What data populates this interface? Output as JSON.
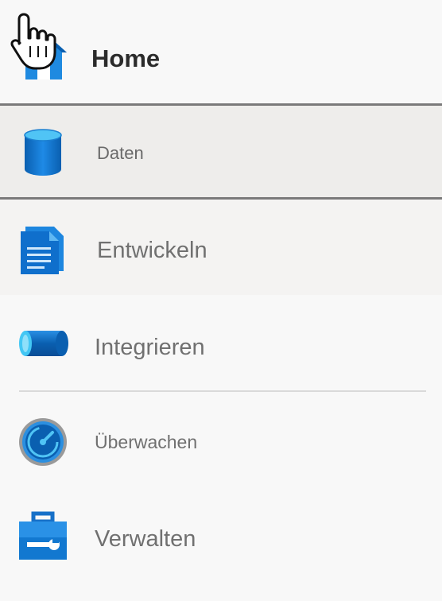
{
  "nav": {
    "items": [
      {
        "id": "home",
        "label": "Home",
        "icon": "home-icon"
      },
      {
        "id": "daten",
        "label": "Daten",
        "icon": "database-icon",
        "selected": true
      },
      {
        "id": "entwickeln",
        "label": "Entwickeln",
        "icon": "document-icon"
      },
      {
        "id": "integrieren",
        "label": "Integrieren",
        "icon": "pipeline-icon"
      },
      {
        "id": "ueberwachen",
        "label": "Überwachen",
        "icon": "gauge-icon"
      },
      {
        "id": "verwalten",
        "label": "Verwalten",
        "icon": "toolbox-icon"
      }
    ]
  },
  "colors": {
    "accent": "#0078d4",
    "selected_bg": "#eeedeb",
    "text": "#707070",
    "home_text": "#2b2b2b"
  },
  "cursor": {
    "icon": "hand-pointer-icon"
  }
}
